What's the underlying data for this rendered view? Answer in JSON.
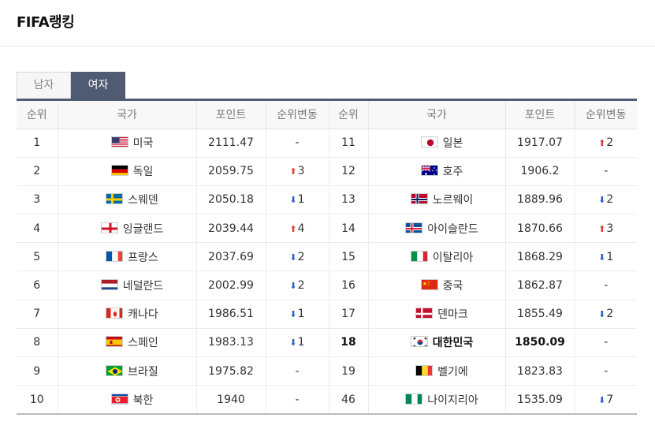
{
  "page": {
    "title": "FIFA랭킹"
  },
  "tabs": [
    {
      "label": "남자",
      "active": false
    },
    {
      "label": "여자",
      "active": true
    }
  ],
  "table": {
    "headers": [
      "순위",
      "국가",
      "포인트",
      "순위변동",
      "순위",
      "국가",
      "포인트",
      "순위변동"
    ],
    "left": [
      {
        "rank": "1",
        "country": "미국",
        "flag": "usa-flag-icon",
        "points": "2111.47",
        "change": "-",
        "dir": "none"
      },
      {
        "rank": "2",
        "country": "독일",
        "flag": "germany-flag-icon",
        "points": "2059.75",
        "change": "3",
        "dir": "up"
      },
      {
        "rank": "3",
        "country": "스웨덴",
        "flag": "sweden-flag-icon",
        "points": "2050.18",
        "change": "1",
        "dir": "down"
      },
      {
        "rank": "4",
        "country": "잉글랜드",
        "flag": "england-flag-icon",
        "points": "2039.44",
        "change": "4",
        "dir": "up"
      },
      {
        "rank": "5",
        "country": "프랑스",
        "flag": "france-flag-icon",
        "points": "2037.69",
        "change": "2",
        "dir": "down"
      },
      {
        "rank": "6",
        "country": "네덜란드",
        "flag": "netherlands-flag-icon",
        "points": "2002.99",
        "change": "2",
        "dir": "down"
      },
      {
        "rank": "7",
        "country": "캐나다",
        "flag": "canada-flag-icon",
        "points": "1986.51",
        "change": "1",
        "dir": "down"
      },
      {
        "rank": "8",
        "country": "스페인",
        "flag": "spain-flag-icon",
        "points": "1983.13",
        "change": "1",
        "dir": "down"
      },
      {
        "rank": "9",
        "country": "브라질",
        "flag": "brazil-flag-icon",
        "points": "1975.82",
        "change": "-",
        "dir": "none"
      },
      {
        "rank": "10",
        "country": "북한",
        "flag": "north-korea-flag-icon",
        "points": "1940",
        "change": "-",
        "dir": "none"
      }
    ],
    "right": [
      {
        "rank": "11",
        "country": "일본",
        "flag": "japan-flag-icon",
        "points": "1917.07",
        "change": "2",
        "dir": "up"
      },
      {
        "rank": "12",
        "country": "호주",
        "flag": "australia-flag-icon",
        "points": "1906.2",
        "change": "-",
        "dir": "none"
      },
      {
        "rank": "13",
        "country": "노르웨이",
        "flag": "norway-flag-icon",
        "points": "1889.96",
        "change": "2",
        "dir": "down"
      },
      {
        "rank": "14",
        "country": "아이슬란드",
        "flag": "iceland-flag-icon",
        "points": "1870.66",
        "change": "3",
        "dir": "up"
      },
      {
        "rank": "15",
        "country": "이탈리아",
        "flag": "italy-flag-icon",
        "points": "1868.29",
        "change": "1",
        "dir": "down"
      },
      {
        "rank": "16",
        "country": "중국",
        "flag": "china-flag-icon",
        "points": "1862.87",
        "change": "-",
        "dir": "none"
      },
      {
        "rank": "17",
        "country": "덴마크",
        "flag": "denmark-flag-icon",
        "points": "1855.49",
        "change": "2",
        "dir": "down"
      },
      {
        "rank": "18",
        "country": "대한민국",
        "flag": "south-korea-flag-icon",
        "points": "1850.09",
        "change": "-",
        "dir": "none",
        "highlight": true
      },
      {
        "rank": "19",
        "country": "벨기에",
        "flag": "belgium-flag-icon",
        "points": "1823.83",
        "change": "-",
        "dir": "none"
      },
      {
        "rank": "46",
        "country": "나이지리아",
        "flag": "nigeria-flag-icon",
        "points": "1535.09",
        "change": "7",
        "dir": "down"
      }
    ]
  },
  "colors": {
    "accent": "#4f5a73",
    "up": "#e23b3b",
    "down": "#2f5fc4"
  }
}
